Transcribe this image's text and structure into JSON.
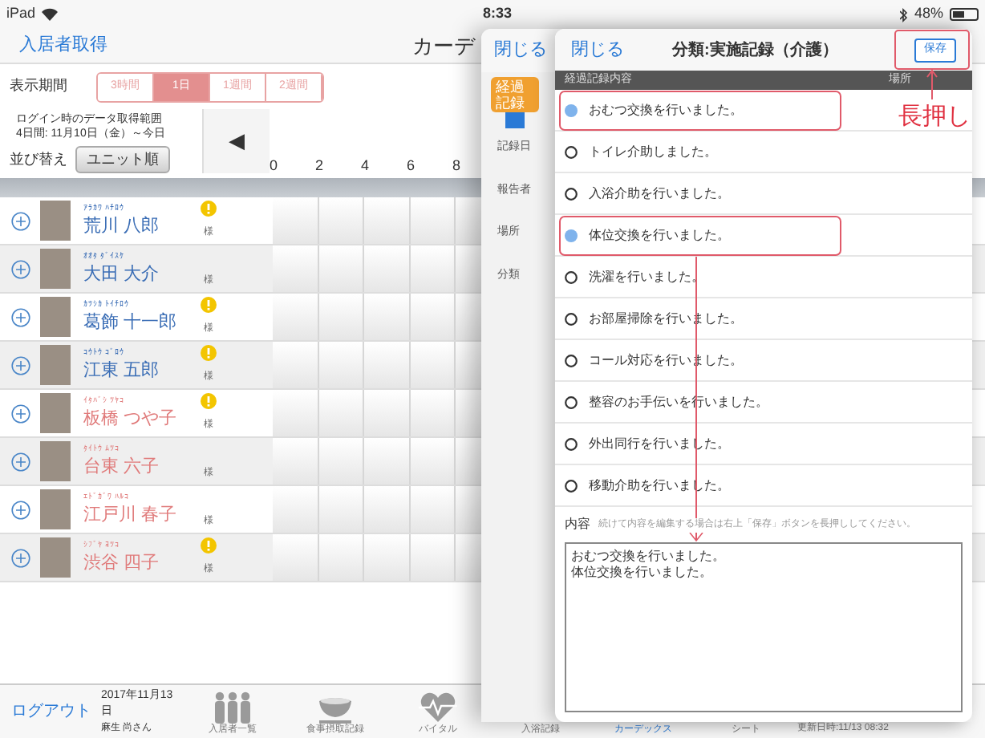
{
  "status_bar": {
    "device": "iPad",
    "time": "8:33",
    "battery": "48%"
  },
  "header": {
    "back": "入居者取得",
    "title": "カーデ"
  },
  "period": {
    "label": "表示期間",
    "options": [
      {
        "label": "3時間",
        "selected": false
      },
      {
        "label": "1日",
        "selected": true
      },
      {
        "label": "1週間",
        "selected": false
      },
      {
        "label": "2週間",
        "selected": false
      }
    ]
  },
  "range": {
    "line1": "ログイン時のデータ取得範囲",
    "line2": "4日間:  11月10日（金）～今日"
  },
  "sort": {
    "label": "並び替え",
    "button": "ユニット順"
  },
  "chart_nav": {
    "prev": "◀",
    "axis": [
      "0",
      "2",
      "4",
      "6",
      "8"
    ]
  },
  "residents": [
    {
      "kana": "ｱﾗｶﾜ ﾊﾁﾛｳ",
      "name": "荒川 八郎",
      "honorific": "様",
      "alert": true,
      "color": "#3a6db5"
    },
    {
      "kana": "ｵｵﾀ ﾀﾞｲｽｹ",
      "name": "大田 大介",
      "honorific": "様",
      "alert": false,
      "color": "#3a6db5"
    },
    {
      "kana": "ｶﾂｼｶ ﾄｲﾁﾛｳ",
      "name": "葛飾 十一郎",
      "honorific": "様",
      "alert": true,
      "color": "#3a6db5"
    },
    {
      "kana": "ｺｳﾄｳ ｺﾞﾛｳ",
      "name": "江東 五郎",
      "honorific": "様",
      "alert": true,
      "color": "#3a6db5"
    },
    {
      "kana": "ｲﾀﾊﾞｼ ﾂﾔｺ",
      "name": "板橋 つや子",
      "honorific": "様",
      "alert": true,
      "color": "#e07b7b"
    },
    {
      "kana": "ﾀｲﾄｳ ﾑﾂｺ",
      "name": "台東 六子",
      "honorific": "様",
      "alert": false,
      "color": "#e07b7b"
    },
    {
      "kana": "ｴﾄﾞｶﾞﾜ ﾊﾙｺ",
      "name": "江戸川 春子",
      "honorific": "様",
      "alert": false,
      "color": "#e07b7b"
    },
    {
      "kana": "ｼﾌﾞﾔ ﾖﾂｺ",
      "name": "渋谷 四子",
      "honorific": "様",
      "alert": true,
      "color": "#e07b7b"
    }
  ],
  "footer": {
    "logout": "ログアウト",
    "date": "2017年11月13日",
    "user": "麻生 尚さん",
    "tabs": [
      {
        "label": "入居者一覧",
        "selected": false
      },
      {
        "label": "食事摂取記録",
        "selected": false
      },
      {
        "label": "バイタル",
        "selected": false
      },
      {
        "label": "入浴記録",
        "selected": false
      },
      {
        "label": "カーデックス",
        "selected": true
      },
      {
        "label": "シート",
        "selected": false
      }
    ],
    "updated": "更新日時:11/13 08:32"
  },
  "back_panel": {
    "close": "閉じる",
    "badge": "経過記録",
    "fields": [
      "記録日",
      "報告者",
      "場所",
      "分類"
    ]
  },
  "dialog": {
    "close": "閉じる",
    "title": "分類:実施記録（介護）",
    "save": "保存",
    "columns": [
      "経過記録内容",
      "場所"
    ],
    "options": [
      {
        "label": "おむつ交換を行いました。",
        "selected": true,
        "highlighted": true
      },
      {
        "label": "トイレ介助しました。",
        "selected": false,
        "highlighted": false
      },
      {
        "label": "入浴介助を行いました。",
        "selected": false,
        "highlighted": false
      },
      {
        "label": "体位交換を行いました。",
        "selected": true,
        "highlighted": true
      },
      {
        "label": "洗濯を行いました。",
        "selected": false,
        "highlighted": false
      },
      {
        "label": "お部屋掃除を行いました。",
        "selected": false,
        "highlighted": false
      },
      {
        "label": "コール対応を行いました。",
        "selected": false,
        "highlighted": false
      },
      {
        "label": "整容のお手伝いを行いました。",
        "selected": false,
        "highlighted": false
      },
      {
        "label": "外出同行を行いました。",
        "selected": false,
        "highlighted": false
      },
      {
        "label": "移動介助を行いました。",
        "selected": false,
        "highlighted": false
      }
    ],
    "content_label": "内容",
    "hint": "続けて内容を編集する場合は右上「保存」ボタンを長押ししてください。",
    "content_lines": [
      "おむつ交換を行いました。",
      "体位交換を行いました。"
    ]
  },
  "annotation": {
    "label": "長押し"
  }
}
